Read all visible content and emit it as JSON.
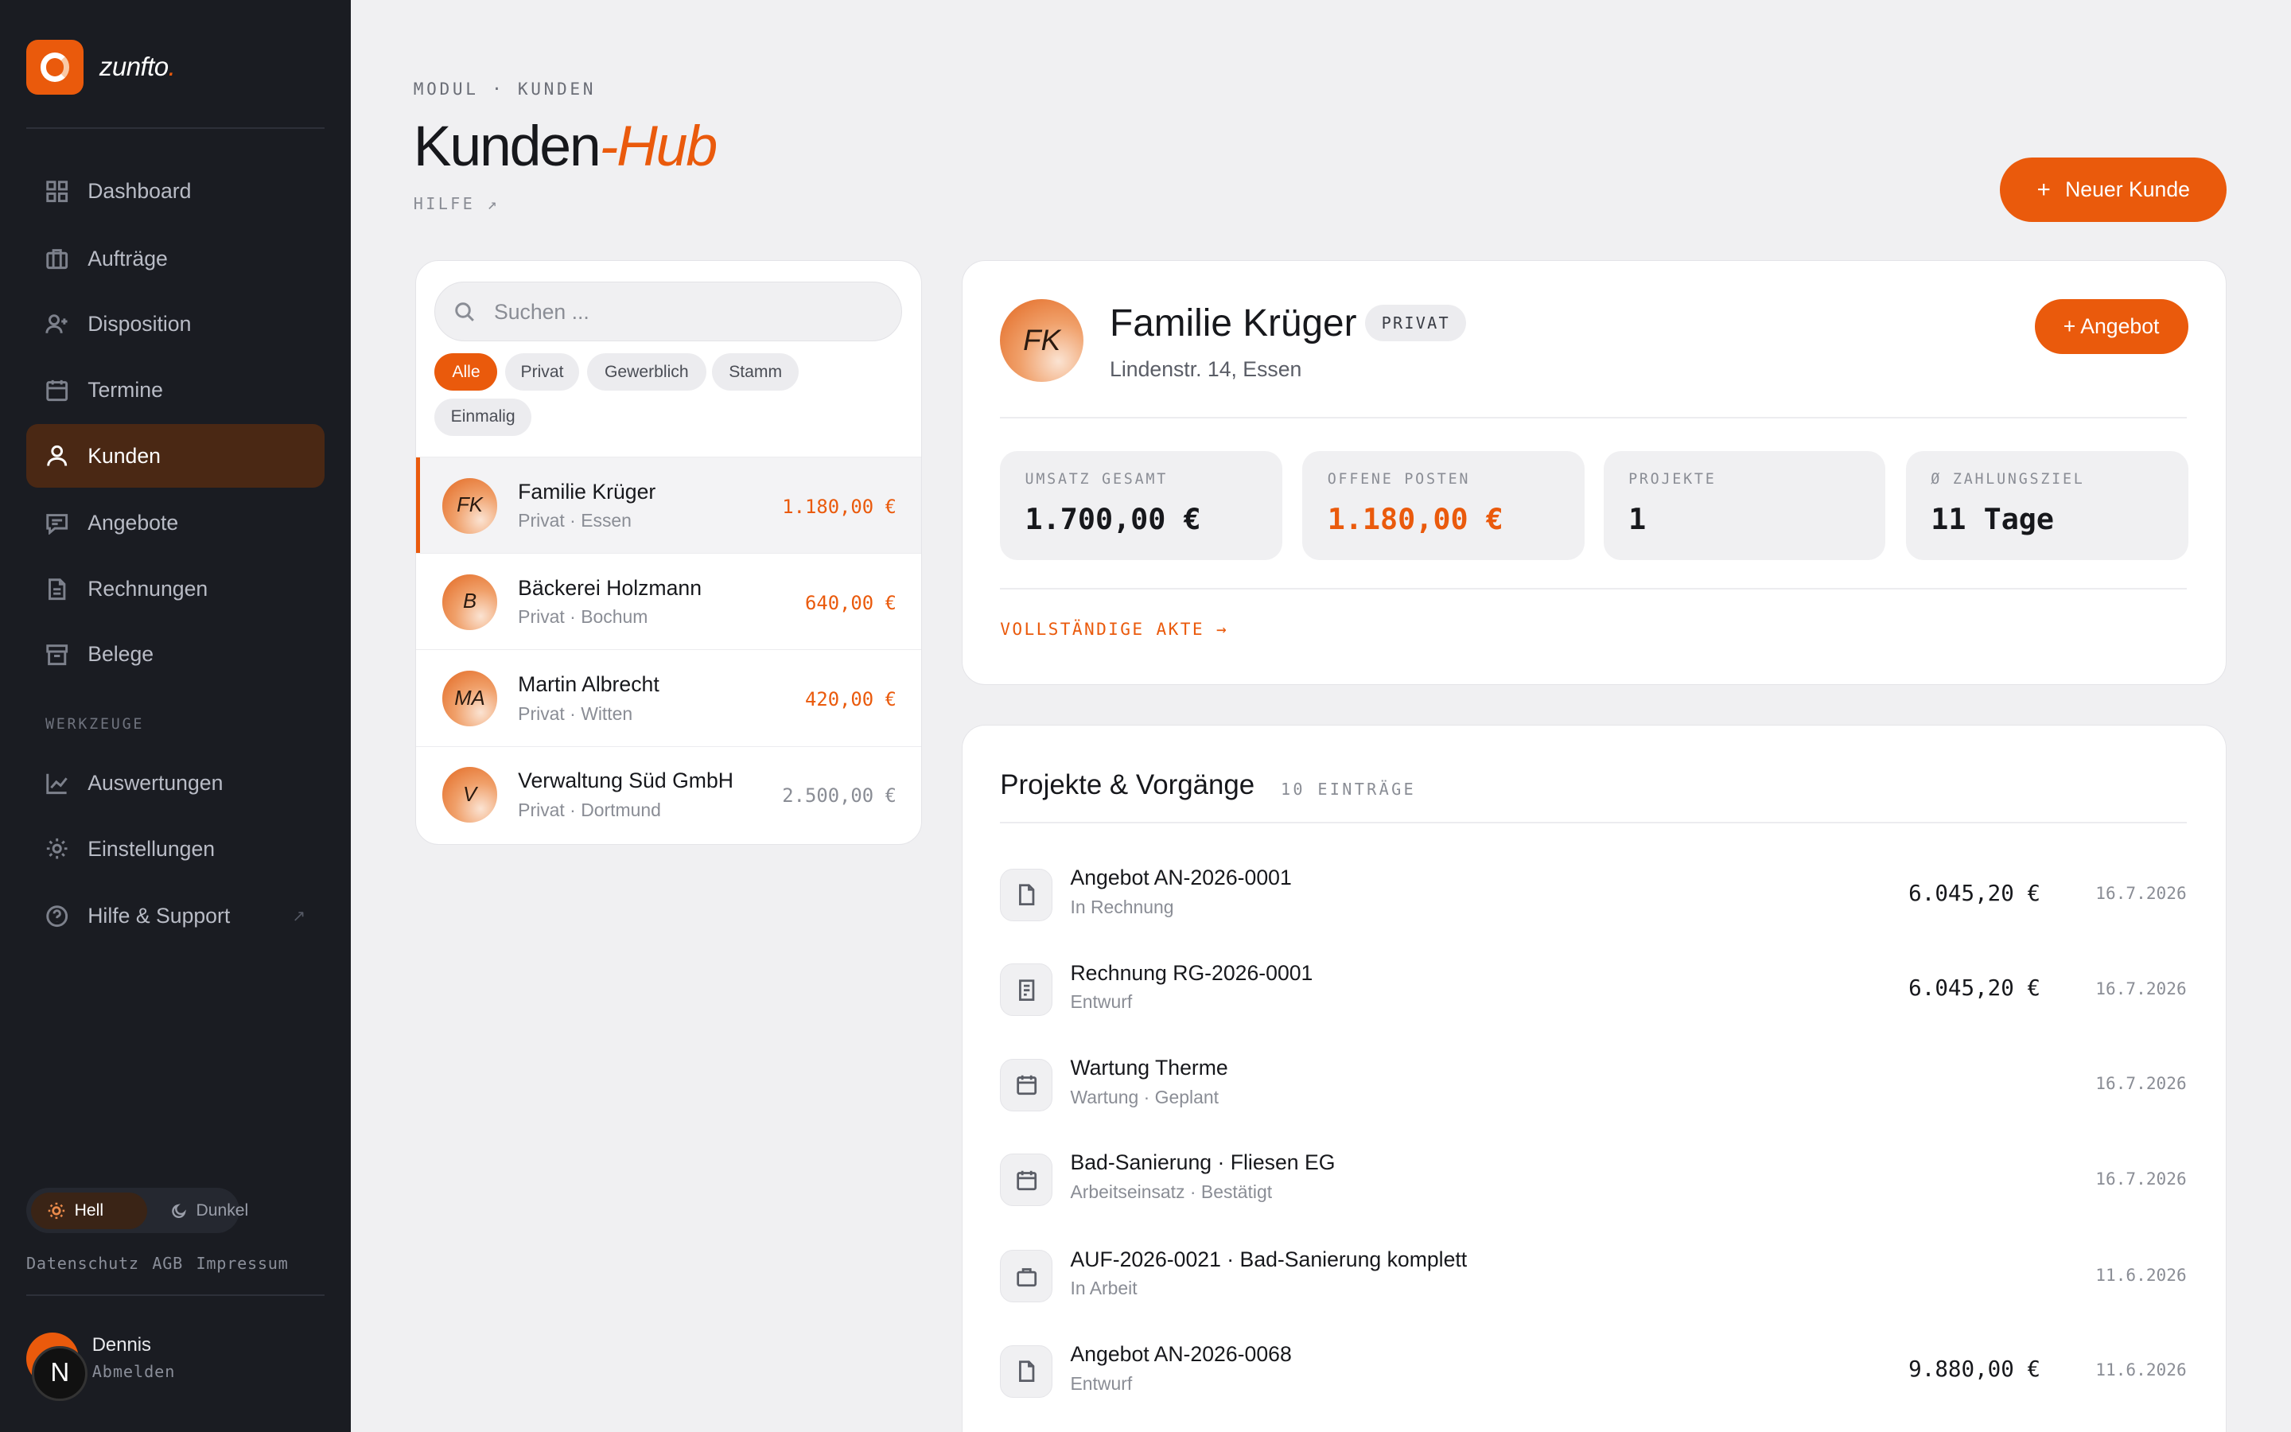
{
  "brand": {
    "name": "zunfto",
    "dot": "."
  },
  "sidebar": {
    "items": [
      {
        "label": "Dashboard",
        "icon": "grid-icon"
      },
      {
        "label": "Aufträge",
        "icon": "briefcase-icon"
      },
      {
        "label": "Disposition",
        "icon": "user-plus-icon"
      },
      {
        "label": "Termine",
        "icon": "calendar-icon"
      },
      {
        "label": "Kunden",
        "icon": "user-icon",
        "active": true
      },
      {
        "label": "Angebote",
        "icon": "message-icon"
      },
      {
        "label": "Rechnungen",
        "icon": "document-icon"
      },
      {
        "label": "Belege",
        "icon": "archive-icon"
      }
    ],
    "tools_heading": "WERKZEUGE",
    "tools": [
      {
        "label": "Auswertungen",
        "icon": "chart-icon"
      },
      {
        "label": "Einstellungen",
        "icon": "gear-icon"
      },
      {
        "label": "Hilfe & Support",
        "icon": "help-icon",
        "ext": "↗"
      }
    ],
    "theme": {
      "light": "Hell",
      "dark": "Dunkel"
    },
    "legal": [
      "Datenschutz",
      "AGB",
      "Impressum"
    ],
    "user": {
      "name": "Dennis",
      "logout": "Abmelden",
      "initial": "N"
    }
  },
  "header": {
    "eyebrow": "MODUL · KUNDEN",
    "title_main": "Kunden",
    "title_accent": "-Hub",
    "help": "HILFE ↗",
    "new_button_plus": "+",
    "new_button": "Neuer Kunde"
  },
  "list": {
    "search_placeholder": "Suchen ...",
    "filters": [
      "Alle",
      "Privat",
      "Gewerblich",
      "Stamm",
      "Einmalig"
    ],
    "customers": [
      {
        "initials": "FK",
        "name": "Familie Krüger",
        "sub": "Privat · Essen",
        "amount": "1.180,00 €"
      },
      {
        "initials": "B",
        "name": "Bäckerei Holzmann",
        "sub": "Privat · Bochum",
        "amount": "640,00 €"
      },
      {
        "initials": "MA",
        "name": "Martin Albrecht",
        "sub": "Privat · Witten",
        "amount": "420,00 €"
      },
      {
        "initials": "V",
        "name": "Verwaltung Süd GmbH",
        "sub": "Privat · Dortmund",
        "amount": "2.500,00 €"
      }
    ]
  },
  "detail": {
    "initials": "FK",
    "name": "Familie Krüger",
    "badge": "PRIVAT",
    "address": "Lindenstr. 14, Essen",
    "offer_button": "+ Angebot",
    "stats": [
      {
        "label": "UMSATZ GESAMT",
        "value": "1.700,00 €"
      },
      {
        "label": "OFFENE POSTEN",
        "value": "1.180,00 €"
      },
      {
        "label": "PROJEKTE",
        "value": "1"
      },
      {
        "label": "Ø ZAHLUNGSZIEL",
        "value": "11 Tage"
      }
    ],
    "full_link": "VOLLSTÄNDIGE AKTE →"
  },
  "projects": {
    "title": "Projekte & Vorgänge",
    "count": "10 EINTRÄGE",
    "items": [
      {
        "icon": "file-icon",
        "name": "Angebot AN-2026-0001",
        "sub": "In Rechnung",
        "amount": "6.045,20 €",
        "date": "16.7.2026"
      },
      {
        "icon": "receipt-icon",
        "name": "Rechnung RG-2026-0001",
        "sub": "Entwurf",
        "amount": "6.045,20 €",
        "date": "16.7.2026"
      },
      {
        "icon": "calendar-icon",
        "name": "Wartung Therme",
        "sub": "Wartung · Geplant",
        "amount": "",
        "date": "16.7.2026"
      },
      {
        "icon": "calendar-icon",
        "name": "Bad-Sanierung · Fliesen EG",
        "sub": "Arbeitseinsatz · Bestätigt",
        "amount": "",
        "date": "16.7.2026"
      },
      {
        "icon": "briefcase-icon",
        "name": "AUF-2026-0021 · Bad-Sanierung komplett",
        "sub": "In Arbeit",
        "amount": "",
        "date": "11.6.2026"
      },
      {
        "icon": "file-icon",
        "name": "Angebot AN-2026-0068",
        "sub": "Entwurf",
        "amount": "9.880,00 €",
        "date": "11.6.2026"
      }
    ]
  }
}
